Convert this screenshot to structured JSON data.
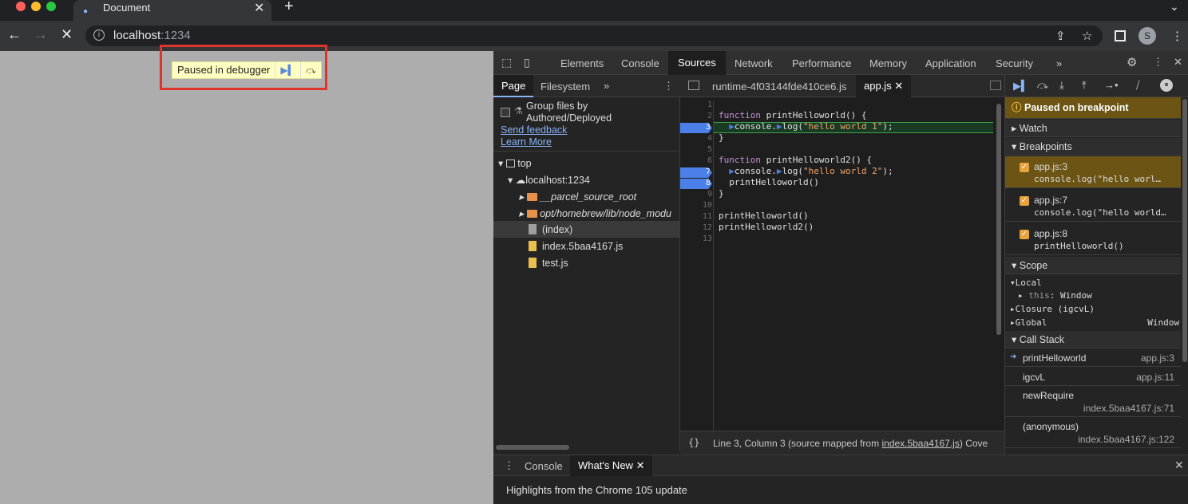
{
  "browser": {
    "tab_title": "Document",
    "url_host": "localhost",
    "url_port": ":1234",
    "avatar_letter": "S"
  },
  "page": {
    "paused_label": "Paused in debugger"
  },
  "devtools": {
    "tabs": [
      "Elements",
      "Console",
      "Sources",
      "Network",
      "Performance",
      "Memory",
      "Application",
      "Security"
    ],
    "active_tab": "Sources",
    "more": "»",
    "navigator": {
      "tabs": [
        "Page",
        "Filesystem"
      ],
      "group_label_1": "Group files by",
      "group_label_2": "Authored/Deployed",
      "send_feedback": "Send feedback",
      "learn_more": "Learn More",
      "tree": {
        "top": "top",
        "host": "localhost:1234",
        "folder1": "__parcel_source_root",
        "folder2": "opt/homebrew/lib/node_modu",
        "file_index": "(index)",
        "file_js": "index.5baa4167.js",
        "file_test": "test.js"
      }
    },
    "editor": {
      "tabs": [
        "runtime-4f03144fde410ce6.js",
        "app.js"
      ],
      "lines": [
        "",
        "function printHelloworld() {",
        "  console.log(\"hello world 1\");",
        "}",
        "",
        "function printHelloworld2() {",
        "  console.log(\"hello world 2\");",
        "  printHelloworld()",
        "}",
        "",
        "printHelloworld()",
        "printHelloworld2()",
        ""
      ],
      "status_text": "Line 3, Column 3  (source mapped from ",
      "status_link": "index.5baa4167.js",
      "status_tail": ")  Cove"
    },
    "debugger": {
      "paused_banner": "Paused on breakpoint",
      "watch": "Watch",
      "breakpoints_header": "Breakpoints",
      "breakpoints": [
        {
          "file": "app.js:3",
          "code": "console.log(\"hello worl…"
        },
        {
          "file": "app.js:7",
          "code": "console.log(\"hello world…"
        },
        {
          "file": "app.js:8",
          "code": "printHelloworld()"
        }
      ],
      "scope_header": "Scope",
      "scope_local": "Local",
      "scope_this_key": "this",
      "scope_this_val": "Window",
      "scope_closure": "Closure (igcvL)",
      "scope_global": "Global",
      "scope_global_val": "Window",
      "callstack_header": "Call Stack",
      "callstack": [
        {
          "fn": "printHelloworld",
          "loc": "app.js:3"
        },
        {
          "fn": "igcvL",
          "loc": "app.js:11"
        },
        {
          "fn": "newRequire",
          "loc": "index.5baa4167.js:71"
        },
        {
          "fn": "(anonymous)",
          "loc": "index.5baa4167.js:122"
        }
      ]
    },
    "drawer": {
      "tabs": [
        "Console",
        "What's New"
      ],
      "content": "Highlights from the Chrome 105 update"
    }
  }
}
